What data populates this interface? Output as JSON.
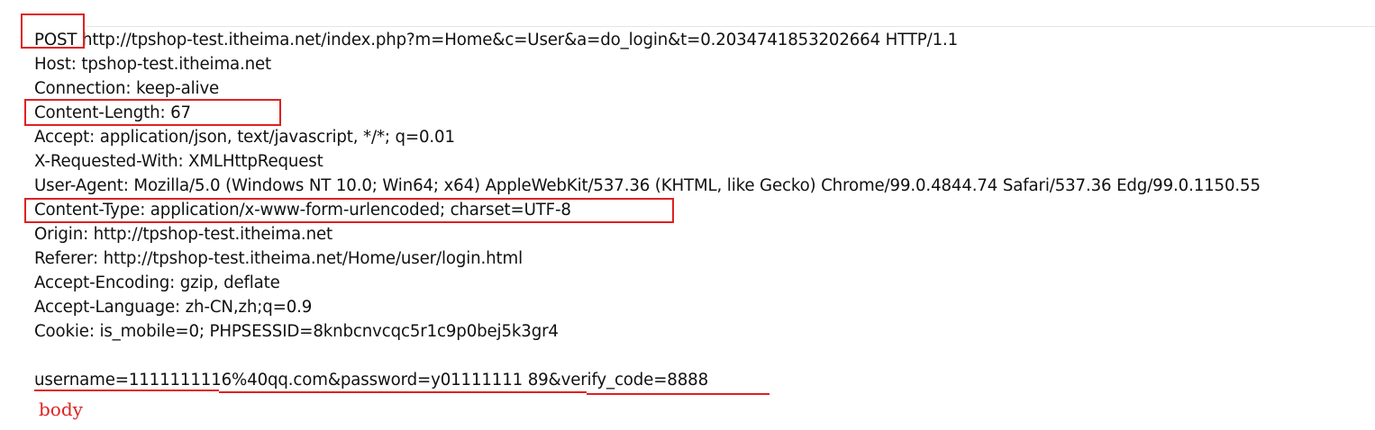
{
  "request": {
    "lines": [
      "POST http://tpshop-test.itheima.net/index.php?m=Home&c=User&a=do_login&t=0.2034741853202664 HTTP/1.1",
      "Host: tpshop-test.itheima.net",
      "Connection: keep-alive",
      "Content-Length: 67",
      "Accept: application/json, text/javascript, */*; q=0.01",
      "X-Requested-With: XMLHttpRequest",
      "User-Agent: Mozilla/5.0 (Windows NT 10.0; Win64; x64) AppleWebKit/537.36 (KHTML, like Gecko) Chrome/99.0.4844.74 Safari/537.36 Edg/99.0.1150.55",
      "Content-Type: application/x-www-form-urlencoded; charset=UTF-8",
      "Origin: http://tpshop-test.itheima.net",
      "Referer: http://tpshop-test.itheima.net/Home/user/login.html",
      "Accept-Encoding: gzip, deflate",
      "Accept-Language: zh-CN,zh;q=0.9",
      "Cookie: is_mobile=0; PHPSESSID=8knbcnvcqc5r1c9p0bej5k3gr4",
      "",
      "username=1111111116%40qq.com&password=y01111111 89&verify_code=8888"
    ]
  },
  "annotation": {
    "body_label": "body",
    "color": "#e02020"
  }
}
